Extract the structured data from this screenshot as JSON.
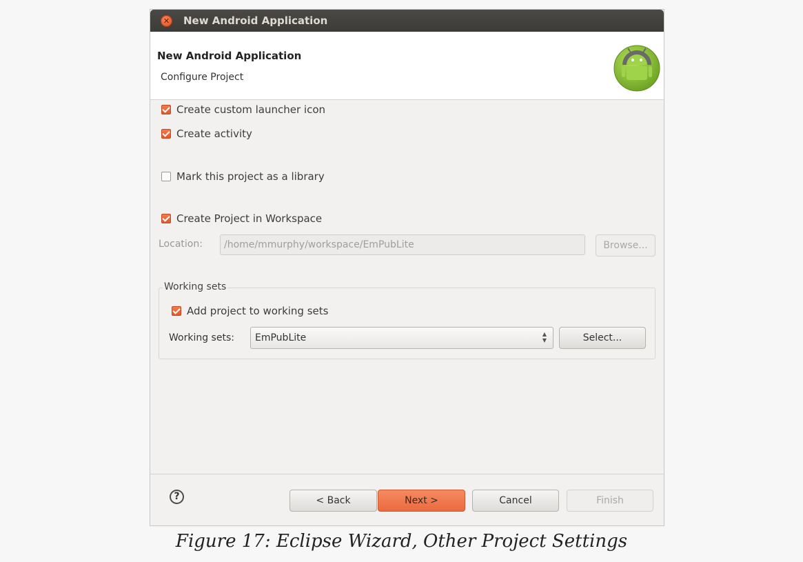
{
  "window": {
    "title": "New Android Application"
  },
  "header": {
    "title": "New Android Application",
    "subtitle": "Configure Project",
    "logo_icon": "android-icon"
  },
  "options": {
    "custom_launcher": {
      "label": "Create custom launcher icon",
      "checked": true
    },
    "create_activity": {
      "label": "Create activity",
      "checked": true
    },
    "library": {
      "label": "Mark this project as a library",
      "checked": false
    },
    "in_workspace": {
      "label": "Create Project in Workspace",
      "checked": true
    }
  },
  "location": {
    "label": "Location:",
    "value": "/home/mmurphy/workspace/EmPubLite",
    "browse_label": "Browse..."
  },
  "working_sets": {
    "legend": "Working sets",
    "add_label": "Add project to working sets",
    "add_checked": true,
    "sets_label": "Working sets:",
    "selected": "EmPubLite",
    "select_button": "Select..."
  },
  "footer": {
    "help_glyph": "?",
    "back": "< Back",
    "next": "Next >",
    "cancel": "Cancel",
    "finish": "Finish"
  },
  "caption": "Figure 17: Eclipse Wizard, Other Project Settings",
  "colors": {
    "accent": "#e8643a",
    "titlebar": "#3c3b37"
  }
}
